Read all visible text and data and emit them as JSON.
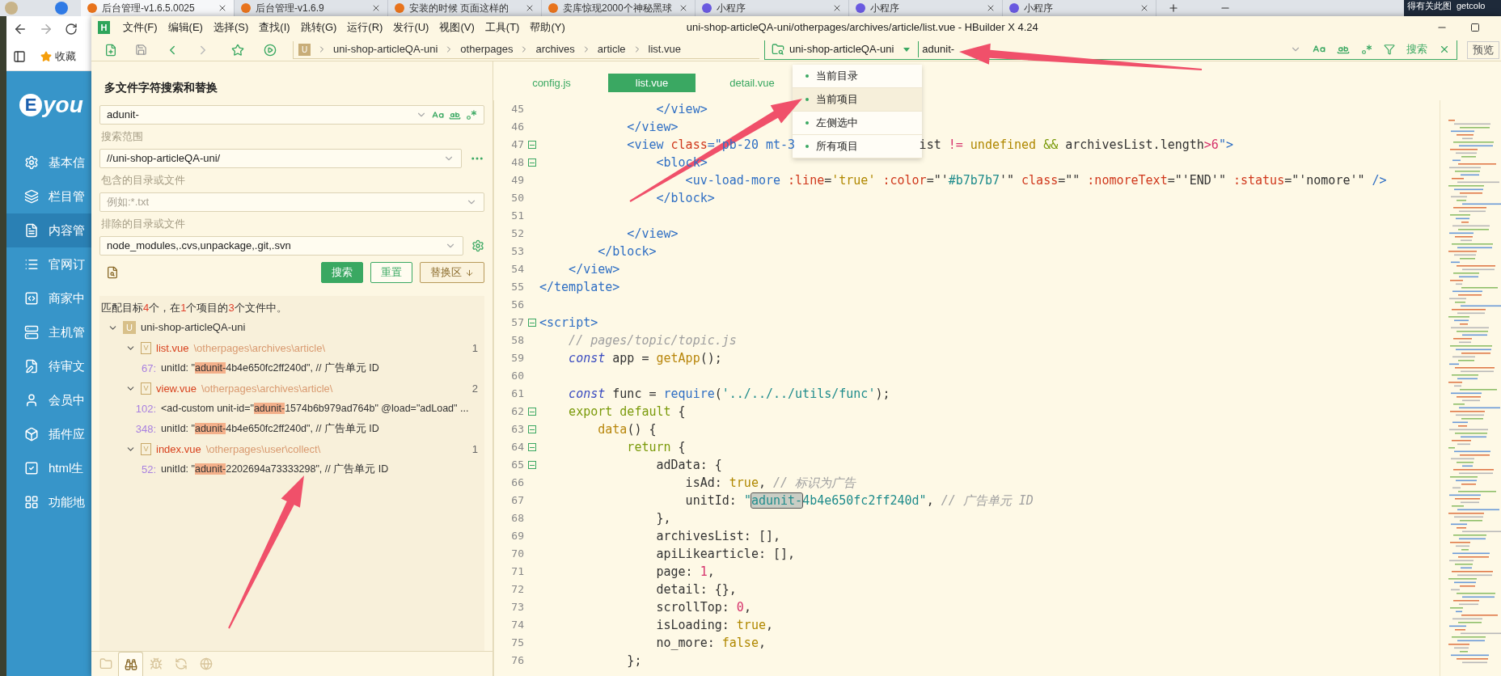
{
  "browser": {
    "tabs": [
      {
        "title": "后台管理-v1.6.5.0025",
        "selected": true
      },
      {
        "title": "后台管理-v1.6.9",
        "selected": false
      },
      {
        "title": "安装的时候 页面这样的",
        "selected": false
      },
      {
        "title": "卖库惊现2000个神秘黑球",
        "selected": false
      },
      {
        "title": "小程序",
        "selected": false
      },
      {
        "title": "小程序",
        "selected": false
      },
      {
        "title": "小程序",
        "selected": false
      }
    ],
    "corner_texts": [
      "得有关此图",
      "getcolo"
    ],
    "bookmark": "收藏",
    "sidebar": {
      "logo_mark": "E",
      "logo_text": "you",
      "items": [
        {
          "label": "基本信",
          "selected": false
        },
        {
          "label": "栏目管",
          "selected": false
        },
        {
          "label": "内容管",
          "selected": true
        },
        {
          "label": "官网订",
          "selected": false
        },
        {
          "label": "商家中",
          "selected": false
        },
        {
          "label": "主机管",
          "selected": false
        },
        {
          "label": "待审文",
          "selected": false
        },
        {
          "label": "会员中",
          "selected": false
        },
        {
          "label": "插件应",
          "selected": false
        },
        {
          "label": "html生",
          "selected": false
        },
        {
          "label": "功能地",
          "selected": false
        }
      ]
    }
  },
  "ide": {
    "logo": "H",
    "menu": [
      "文件(F)",
      "编辑(E)",
      "选择(S)",
      "查找(I)",
      "跳转(G)",
      "运行(R)",
      "发行(U)",
      "视图(V)",
      "工具(T)",
      "帮助(Y)"
    ],
    "title": "uni-shop-articleQA-uni/otherpages/archives/article/list.vue - HBuilder X 4.24",
    "breadcrumb": {
      "badge": "U",
      "parts": [
        "uni-shop-articleQA-uni",
        "otherpages",
        "archives",
        "article",
        "list.vue"
      ]
    },
    "search_bar": {
      "scope": "uni-shop-articleQA-uni",
      "value": "adunit-",
      "button": "搜索"
    },
    "preview_button": "预览",
    "scope_menu": [
      {
        "label": "当前目录",
        "selected": false
      },
      {
        "label": "当前项目",
        "selected": true
      },
      {
        "label": "左侧选中",
        "selected": false
      },
      {
        "label": "所有项目",
        "selected": false
      }
    ],
    "search_panel": {
      "title": "多文件字符搜索和替换",
      "query": {
        "value": "adunit-"
      },
      "scope_label": "搜索范围",
      "scope": {
        "value": "//uni-shop-articleQA-uni/"
      },
      "include_label": "包含的目录或文件",
      "include": {
        "placeholder": "例如:*.txt"
      },
      "exclude_label": "排除的目录或文件",
      "exclude": {
        "value": "node_modules,.cvs,unpackage,.git,.svn"
      },
      "buttons": [
        {
          "label": "搜索",
          "kind": "primary"
        },
        {
          "label": "重置",
          "kind": "outline"
        },
        {
          "label": "替换区",
          "kind": "toggle"
        }
      ],
      "summary": [
        {
          "text": "匹配目标",
          "kind": "plain"
        },
        {
          "text": "4",
          "kind": "count"
        },
        {
          "text": "个，在",
          "kind": "plain"
        },
        {
          "text": "1",
          "kind": "count"
        },
        {
          "text": "个项目的",
          "kind": "plain"
        },
        {
          "text": "3",
          "kind": "count"
        },
        {
          "text": "个文件中。",
          "kind": "plain"
        }
      ],
      "results": [
        {
          "badge": "U",
          "name": "uni-shop-articleQA-uni",
          "expanded": true,
          "children": [
            {
              "badge": "V",
              "name": "list.vue",
              "path": "\\otherpages\\archives\\article\\",
              "count": "1",
              "expanded": true,
              "children": [
                {
                  "line": "67:",
                  "before": "unitId: \"",
                  "match": "adunit-",
                  "after": "4b4e650fc2ff240d\", // 广告单元 ID"
                }
              ]
            },
            {
              "badge": "V",
              "name": "view.vue",
              "path": "\\otherpages\\archives\\article\\",
              "count": "2",
              "expanded": true,
              "children": [
                {
                  "line": "102:",
                  "before": "<ad-custom unit-id=\"",
                  "match": "adunit-",
                  "after": "1574b6b979ad764b\" @load=\"adLoad\" ..."
                },
                {
                  "line": "348:",
                  "before": "unitId: \"",
                  "match": "adunit-",
                  "after": "4b4e650fc2ff240d\", // 广告单元 ID"
                }
              ]
            },
            {
              "badge": "V",
              "name": "index.vue",
              "path": "\\otherpages\\user\\collect\\",
              "count": "1",
              "expanded": true,
              "children": [
                {
                  "line": "52:",
                  "before": "unitId: \"",
                  "match": "adunit-",
                  "after": "2202694a73333298\", // 广告单元 ID"
                }
              ]
            }
          ]
        }
      ],
      "bottom_tabs": [
        {
          "selected": false
        },
        {
          "selected": true
        },
        {
          "selected": false
        },
        {
          "selected": false
        },
        {
          "selected": false
        }
      ]
    },
    "editor": {
      "tabs": [
        {
          "label": "config.js",
          "selected": false
        },
        {
          "label": "list.vue",
          "selected": true
        },
        {
          "label": "detail.vue",
          "selected": false
        }
      ],
      "lines": [
        {
          "n": "45",
          "fold": false,
          "tokens": [
            {
              "kind": "tag",
              "text": "                </view>"
            }
          ]
        },
        {
          "n": "46",
          "fold": false,
          "tokens": [
            {
              "kind": "tag",
              "text": "            </view>"
            }
          ]
        },
        {
          "n": "47",
          "fold": true,
          "tokens": [
            {
              "kind": "tag",
              "text": "            <view "
            },
            {
              "kind": "attr",
              "text": "class"
            },
            {
              "kind": "tag",
              "text": "=\"pb-20 mt-3"
            },
            {
              "kind": "gap"
            },
            {
              "kind": "plain",
              "text": "ist "
            },
            {
              "kind": "op",
              "text": "!="
            },
            {
              "kind": "lit",
              "text": " undefined"
            },
            {
              "kind": "kw",
              "text": " &&"
            },
            {
              "kind": "plain",
              "text": " archivesList.length"
            },
            {
              "kind": "op",
              "text": ">"
            },
            {
              "kind": "num",
              "text": "6"
            },
            {
              "kind": "tag",
              "text": "\">"
            }
          ]
        },
        {
          "n": "48",
          "fold": true,
          "tokens": [
            {
              "kind": "tag",
              "text": "                <block>"
            }
          ]
        },
        {
          "n": "49",
          "fold": false,
          "tokens": [
            {
              "kind": "tag",
              "text": "                    <uv-load-more "
            },
            {
              "kind": "attr",
              "text": ":line"
            },
            {
              "kind": "plain",
              "text": "="
            },
            {
              "kind": "lit",
              "text": "'true'"
            },
            {
              "kind": "attr",
              "text": " :color"
            },
            {
              "kind": "plain",
              "text": "=\"'"
            },
            {
              "kind": "str",
              "text": "#b7b7b7"
            },
            {
              "kind": "plain",
              "text": "'\" "
            },
            {
              "kind": "attr",
              "text": "class"
            },
            {
              "kind": "plain",
              "text": "=\"\" "
            },
            {
              "kind": "attr",
              "text": ":nomoreText"
            },
            {
              "kind": "plain",
              "text": "=\"'END'\" "
            },
            {
              "kind": "attr",
              "text": ":status"
            },
            {
              "kind": "plain",
              "text": "=\"'nomore'\" "
            },
            {
              "kind": "tag",
              "text": "/>"
            }
          ]
        },
        {
          "n": "50",
          "fold": false,
          "tokens": [
            {
              "kind": "tag",
              "text": "                </block>"
            }
          ]
        },
        {
          "n": "51",
          "fold": false
        },
        {
          "n": "52",
          "fold": false,
          "tokens": [
            {
              "kind": "tag",
              "text": "            </view>"
            }
          ]
        },
        {
          "n": "53",
          "fold": false,
          "tokens": [
            {
              "kind": "tag",
              "text": "        </block>"
            }
          ]
        },
        {
          "n": "54",
          "fold": false,
          "tokens": [
            {
              "kind": "tag",
              "text": "    </view>"
            }
          ]
        },
        {
          "n": "55",
          "fold": false,
          "tokens": [
            {
              "kind": "tag",
              "text": "</template>"
            }
          ]
        },
        {
          "n": "56",
          "fold": false
        },
        {
          "n": "57",
          "fold": true,
          "tokens": [
            {
              "kind": "tag",
              "text": "<script>"
            }
          ]
        },
        {
          "n": "58",
          "fold": false,
          "tokens": [
            {
              "kind": "com",
              "text": "    // pages/topic/topic.js"
            }
          ]
        },
        {
          "n": "59",
          "fold": false,
          "tokens": [
            {
              "kind": "kwi",
              "text": "    const"
            },
            {
              "kind": "plain",
              "text": " app = "
            },
            {
              "kind": "fn",
              "text": "getApp"
            },
            {
              "kind": "plain",
              "text": "();"
            }
          ]
        },
        {
          "n": "60",
          "fold": false
        },
        {
          "n": "61",
          "fold": false,
          "tokens": [
            {
              "kind": "kwi",
              "text": "    const"
            },
            {
              "kind": "plain",
              "text": " func = "
            },
            {
              "kind": "call",
              "text": "require"
            },
            {
              "kind": "plain",
              "text": "("
            },
            {
              "kind": "str",
              "text": "'../../../utils/func'"
            },
            {
              "kind": "plain",
              "text": ");"
            }
          ]
        },
        {
          "n": "62",
          "fold": true,
          "tokens": [
            {
              "kind": "kw",
              "text": "    export default"
            },
            {
              "kind": "plain",
              "text": " {"
            }
          ]
        },
        {
          "n": "63",
          "fold": true,
          "tokens": [
            {
              "kind": "fn",
              "text": "        data"
            },
            {
              "kind": "plain",
              "text": "() {"
            }
          ]
        },
        {
          "n": "64",
          "fold": true,
          "tokens": [
            {
              "kind": "kw",
              "text": "            return"
            },
            {
              "kind": "plain",
              "text": " {"
            }
          ]
        },
        {
          "n": "65",
          "fold": true,
          "tokens": [
            {
              "kind": "plain",
              "text": "                adData: {"
            }
          ]
        },
        {
          "n": "66",
          "fold": false,
          "tokens": [
            {
              "kind": "plain",
              "text": "                    isAd: "
            },
            {
              "kind": "lit",
              "text": "true"
            },
            {
              "kind": "plain",
              "text": ", "
            },
            {
              "kind": "com",
              "text": "// 标识为广告"
            }
          ]
        },
        {
          "n": "67",
          "fold": false,
          "tokens": [
            {
              "kind": "plain",
              "text": "                    unitId: "
            },
            {
              "kind": "str",
              "text": "\""
            },
            {
              "kind": "hl",
              "text": "adunit-"
            },
            {
              "kind": "str",
              "text": "4b4e650fc2ff240d\""
            },
            {
              "kind": "plain",
              "text": ", "
            },
            {
              "kind": "com",
              "text": "// 广告单元 ID"
            }
          ]
        },
        {
          "n": "68",
          "fold": false,
          "tokens": [
            {
              "kind": "plain",
              "text": "                },"
            }
          ]
        },
        {
          "n": "69",
          "fold": false,
          "tokens": [
            {
              "kind": "plain",
              "text": "                archivesList: [],"
            }
          ]
        },
        {
          "n": "70",
          "fold": false,
          "tokens": [
            {
              "kind": "plain",
              "text": "                apiLikearticle: [],"
            }
          ]
        },
        {
          "n": "71",
          "fold": false,
          "tokens": [
            {
              "kind": "plain",
              "text": "                page: "
            },
            {
              "kind": "num",
              "text": "1"
            },
            {
              "kind": "plain",
              "text": ","
            }
          ]
        },
        {
          "n": "72",
          "fold": false,
          "tokens": [
            {
              "kind": "plain",
              "text": "                detail: {},"
            }
          ]
        },
        {
          "n": "73",
          "fold": false,
          "tokens": [
            {
              "kind": "plain",
              "text": "                scrollTop: "
            },
            {
              "kind": "num",
              "text": "0"
            },
            {
              "kind": "plain",
              "text": ","
            }
          ]
        },
        {
          "n": "74",
          "fold": false,
          "tokens": [
            {
              "kind": "plain",
              "text": "                isLoading: "
            },
            {
              "kind": "lit",
              "text": "true"
            },
            {
              "kind": "plain",
              "text": ","
            }
          ]
        },
        {
          "n": "75",
          "fold": false,
          "tokens": [
            {
              "kind": "plain",
              "text": "                no_more: "
            },
            {
              "kind": "lit",
              "text": "false"
            },
            {
              "kind": "plain",
              "text": ","
            }
          ]
        },
        {
          "n": "76",
          "fold": false,
          "tokens": [
            {
              "kind": "plain",
              "text": "            };"
            }
          ]
        }
      ]
    }
  }
}
